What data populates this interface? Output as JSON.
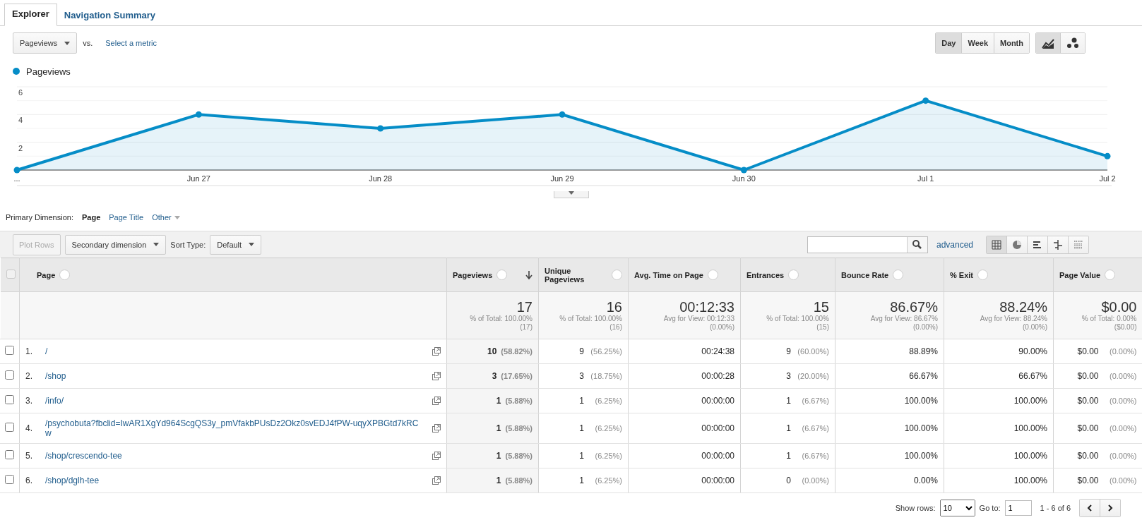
{
  "tabs": [
    {
      "label": "Explorer",
      "selected": true
    },
    {
      "label": "Navigation Summary",
      "selected": false
    }
  ],
  "metric_selector": {
    "value": "Pageviews",
    "vs_label": "vs.",
    "select_metric": "Select a metric"
  },
  "period_buttons": [
    {
      "label": "Day",
      "selected": true
    },
    {
      "label": "Week",
      "selected": false
    },
    {
      "label": "Month",
      "selected": false
    }
  ],
  "chart_type_buttons": [
    {
      "kind": "line",
      "selected": true
    },
    {
      "kind": "motion",
      "selected": false
    }
  ],
  "chart": {
    "chart_data": {
      "type": "area",
      "categories": [
        "...",
        "Jun 27",
        "Jun 28",
        "Jun 29",
        "Jun 30",
        "Jul 1",
        "Jul 2"
      ],
      "series": [
        {
          "name": "Pageviews",
          "color": "#058dc7",
          "values": [
            0,
            4,
            3,
            4,
            0,
            5,
            1
          ]
        }
      ],
      "ylim": [
        0,
        6
      ],
      "yticks": [
        2,
        4,
        6
      ]
    }
  },
  "primary_dimension": {
    "label": "Primary Dimension:",
    "options": [
      {
        "label": "Page",
        "selected": true,
        "kind": "plain"
      },
      {
        "label": "Page Title",
        "selected": false,
        "kind": "plain"
      },
      {
        "label": "Other",
        "selected": false,
        "kind": "menu"
      }
    ]
  },
  "toolbar": {
    "plot_rows": {
      "label": "Plot Rows",
      "disabled": true
    },
    "secondary_dimension": "Secondary dimension",
    "sort_type_label": "Sort Type:",
    "sort_type_value": "Default",
    "advanced": "advanced",
    "view_buttons": [
      {
        "kind": "table",
        "selected": true
      },
      {
        "kind": "pie",
        "selected": false
      },
      {
        "kind": "performance",
        "selected": false
      },
      {
        "kind": "comparison",
        "selected": false
      },
      {
        "kind": "pivot",
        "selected": false
      }
    ]
  },
  "table": {
    "select_all": {
      "checked": false
    },
    "columns": [
      {
        "label": "Page",
        "sorted": false
      },
      {
        "label": "Pageviews",
        "sorted": true
      },
      {
        "label": "Unique Pageviews",
        "sorted": false
      },
      {
        "label": "Avg. Time on Page",
        "sorted": false
      },
      {
        "label": "Entrances",
        "sorted": false
      },
      {
        "label": "Bounce Rate",
        "sorted": false
      },
      {
        "label": "% Exit",
        "sorted": false
      },
      {
        "label": "Page Value",
        "sorted": false
      }
    ],
    "totals": [
      {
        "value": "17",
        "line1": "% of Total: 100.00%",
        "line2": "(17)"
      },
      {
        "value": "16",
        "line1": "% of Total: 100.00%",
        "line2": "(16)"
      },
      {
        "value": "00:12:33",
        "line1": "Avg for View: 00:12:33",
        "line2": "(0.00%)"
      },
      {
        "value": "15",
        "line1": "% of Total: 100.00%",
        "line2": "(15)"
      },
      {
        "value": "86.67%",
        "line1": "Avg for View: 86.67%",
        "line2": "(0.00%)"
      },
      {
        "value": "88.24%",
        "line1": "Avg for View: 88.24%",
        "line2": "(0.00%)"
      },
      {
        "value": "$0.00",
        "line1": "% of Total: 0.00%",
        "line2": "($0.00)"
      }
    ],
    "rows": [
      {
        "checked": false,
        "cells": [
          {
            "index": "1.",
            "value": "/"
          },
          {
            "value": "10",
            "pct": "(58.82%)"
          },
          {
            "value": "9",
            "pct": "(56.25%)"
          },
          {
            "value": "00:24:38"
          },
          {
            "value": "9",
            "pct": "(60.00%)"
          },
          {
            "value": "88.89%"
          },
          {
            "value": "90.00%"
          },
          {
            "value": "$0.00",
            "pct": "(0.00%)"
          }
        ]
      },
      {
        "checked": false,
        "cells": [
          {
            "index": "2.",
            "value": "/shop"
          },
          {
            "value": "3",
            "pct": "(17.65%)"
          },
          {
            "value": "3",
            "pct": "(18.75%)"
          },
          {
            "value": "00:00:28"
          },
          {
            "value": "3",
            "pct": "(20.00%)"
          },
          {
            "value": "66.67%"
          },
          {
            "value": "66.67%"
          },
          {
            "value": "$0.00",
            "pct": "(0.00%)"
          }
        ]
      },
      {
        "checked": false,
        "cells": [
          {
            "index": "3.",
            "value": "/info/"
          },
          {
            "value": "1",
            "pct": "(5.88%)"
          },
          {
            "value": "1",
            "pct": "(6.25%)"
          },
          {
            "value": "00:00:00"
          },
          {
            "value": "1",
            "pct": "(6.67%)"
          },
          {
            "value": "100.00%"
          },
          {
            "value": "100.00%"
          },
          {
            "value": "$0.00",
            "pct": "(0.00%)"
          }
        ]
      },
      {
        "checked": false,
        "cells": [
          {
            "index": "4.",
            "value": "/psychobuta?fbclid=IwAR1XgYd964ScgQS3y_pmVfakbPUsDz2Okz0svEDJ4fPW-uqyXPBGtd7kRCw"
          },
          {
            "value": "1",
            "pct": "(5.88%)"
          },
          {
            "value": "1",
            "pct": "(6.25%)"
          },
          {
            "value": "00:00:00"
          },
          {
            "value": "1",
            "pct": "(6.67%)"
          },
          {
            "value": "100.00%"
          },
          {
            "value": "100.00%"
          },
          {
            "value": "$0.00",
            "pct": "(0.00%)"
          }
        ]
      },
      {
        "checked": false,
        "cells": [
          {
            "index": "5.",
            "value": "/shop/crescendo-tee"
          },
          {
            "value": "1",
            "pct": "(5.88%)"
          },
          {
            "value": "1",
            "pct": "(6.25%)"
          },
          {
            "value": "00:00:00"
          },
          {
            "value": "1",
            "pct": "(6.67%)"
          },
          {
            "value": "100.00%"
          },
          {
            "value": "100.00%"
          },
          {
            "value": "$0.00",
            "pct": "(0.00%)"
          }
        ]
      },
      {
        "checked": false,
        "cells": [
          {
            "index": "6.",
            "value": "/shop/dglh-tee"
          },
          {
            "value": "1",
            "pct": "(5.88%)"
          },
          {
            "value": "1",
            "pct": "(6.25%)"
          },
          {
            "value": "00:00:00"
          },
          {
            "value": "0",
            "pct": "(0.00%)"
          },
          {
            "value": "0.00%"
          },
          {
            "value": "100.00%"
          },
          {
            "value": "$0.00",
            "pct": "(0.00%)"
          }
        ]
      }
    ]
  },
  "pagination": {
    "show_rows_label": "Show rows:",
    "show_rows_value": "10",
    "goto_label": "Go to:",
    "goto_value": "1",
    "range": "1 - 6 of 6"
  }
}
